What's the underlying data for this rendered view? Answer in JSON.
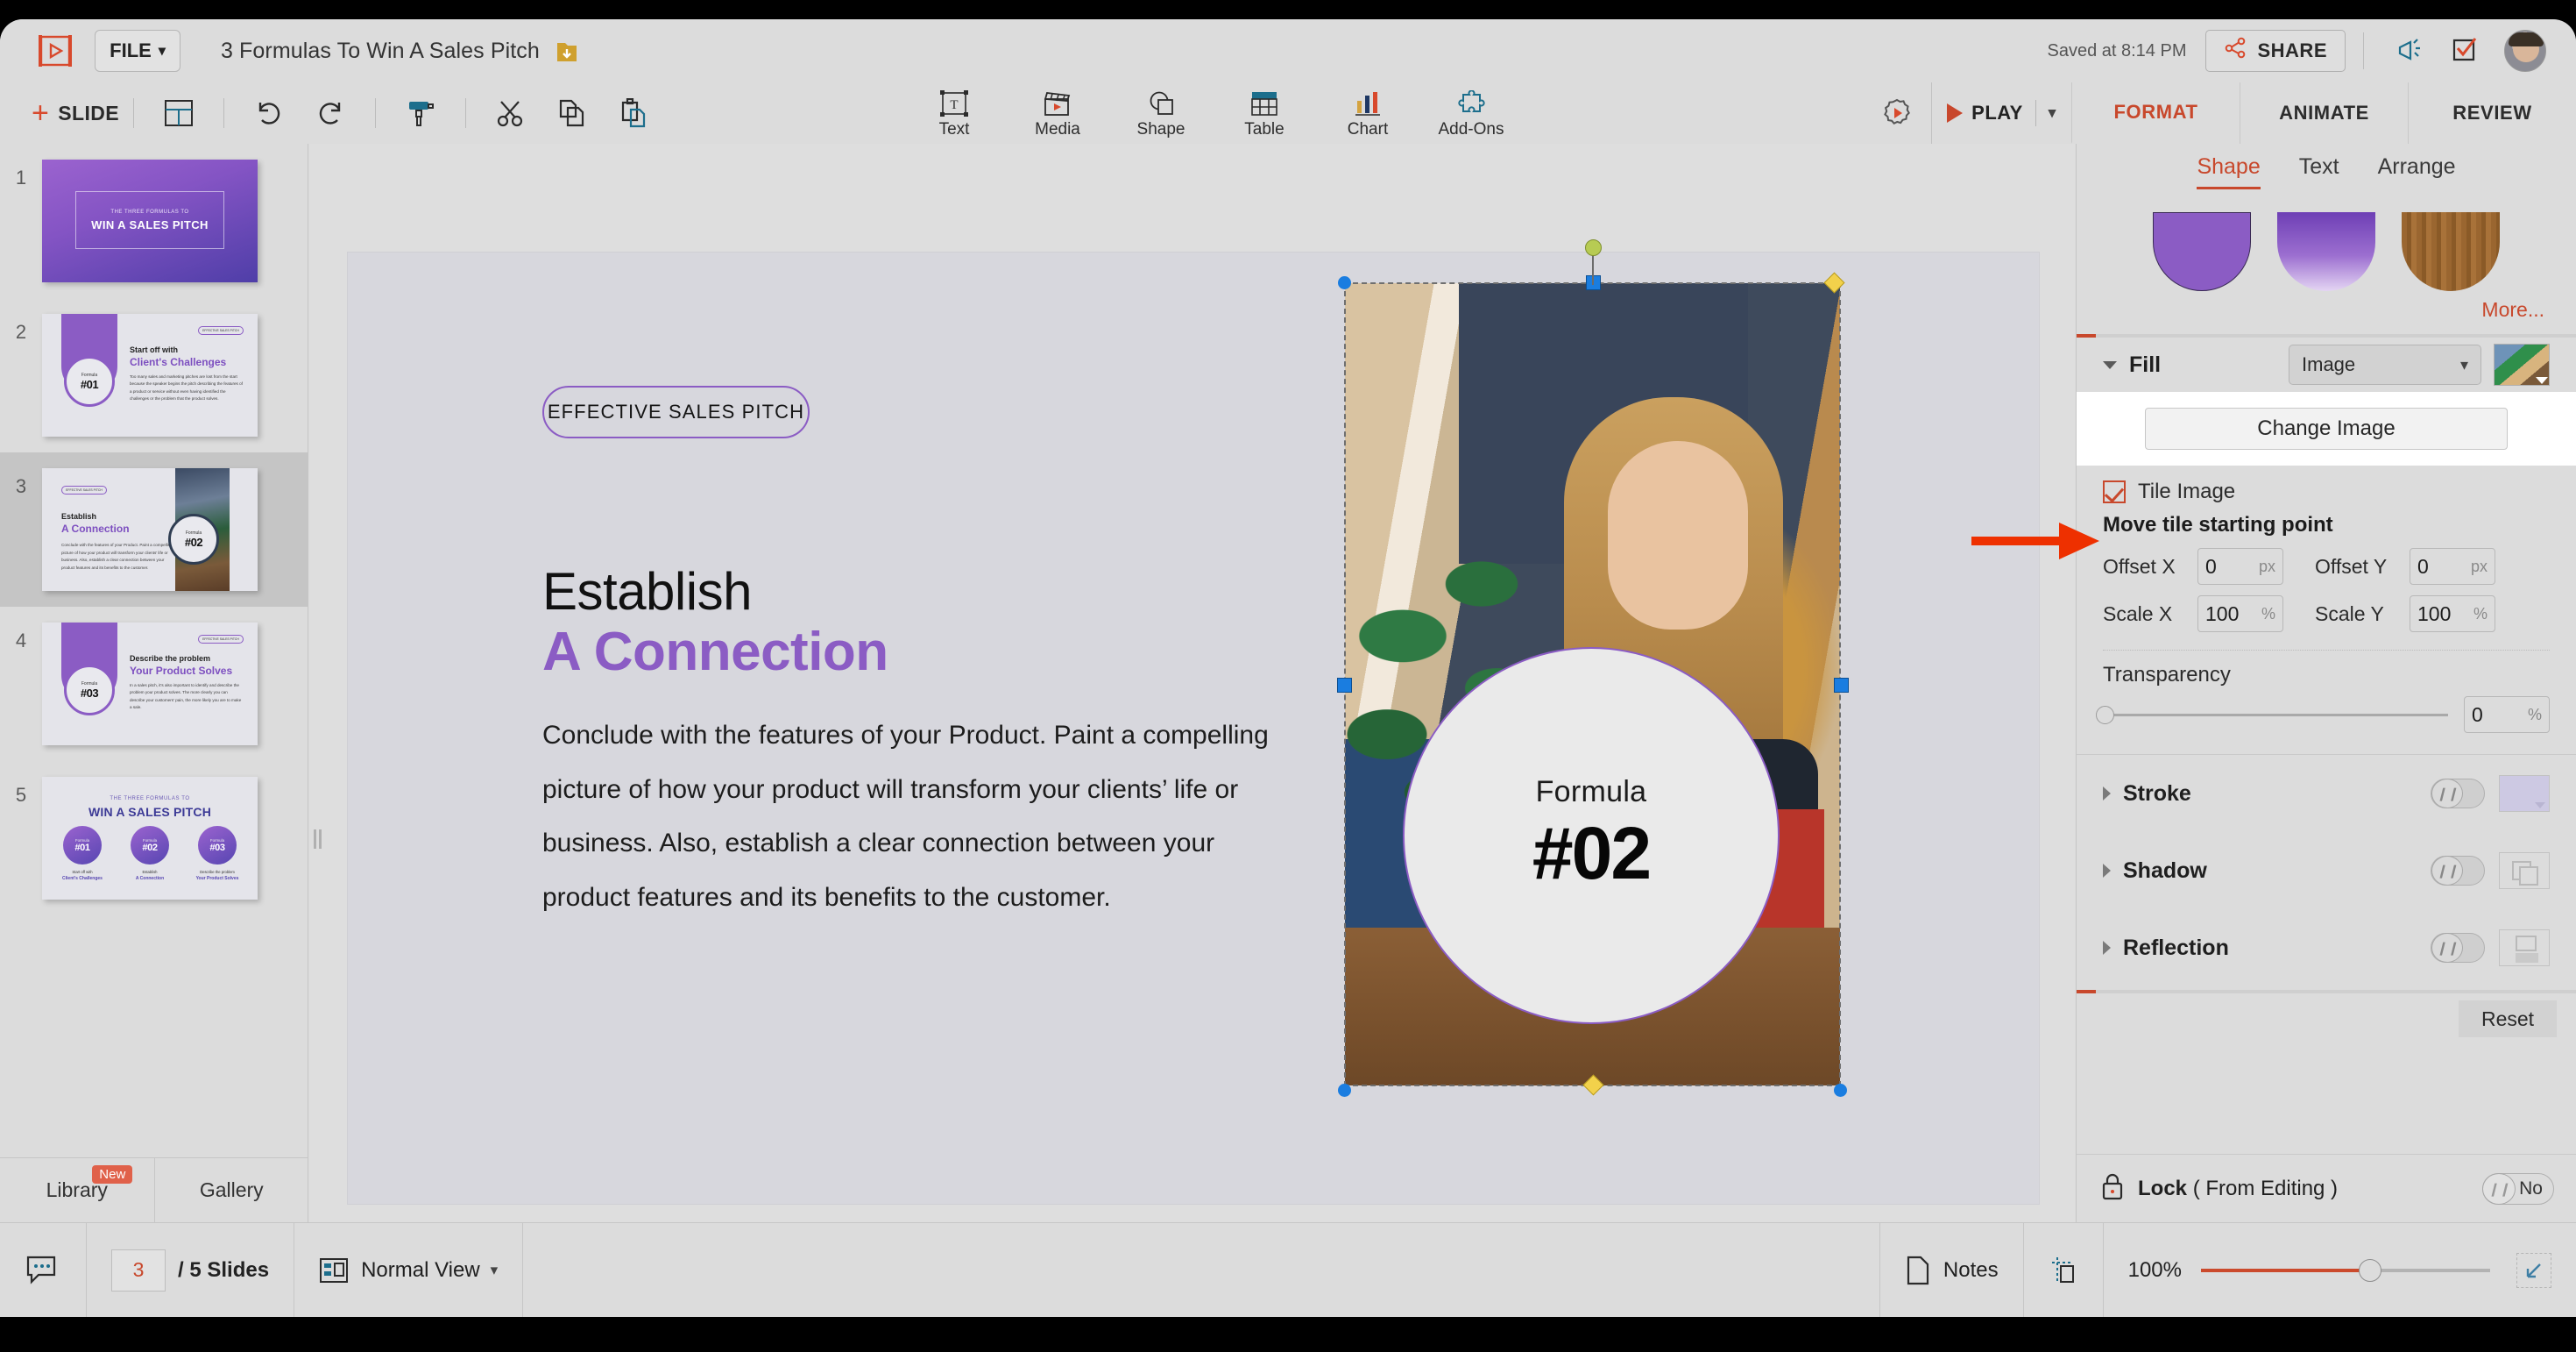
{
  "topbar": {
    "file_label": "FILE",
    "doc_title": "3 Formulas To Win A Sales Pitch",
    "saved_text": "Saved at 8:14 PM",
    "share_label": "SHARE"
  },
  "toolbar": {
    "slide_label": "SLIDE",
    "tools": [
      {
        "name": "text",
        "label": "Text"
      },
      {
        "name": "media",
        "label": "Media"
      },
      {
        "name": "shape",
        "label": "Shape"
      },
      {
        "name": "table",
        "label": "Table"
      },
      {
        "name": "chart",
        "label": "Chart"
      },
      {
        "name": "addons",
        "label": "Add-Ons"
      }
    ],
    "play_label": "PLAY",
    "right_tabs": [
      {
        "label": "FORMAT",
        "active": true
      },
      {
        "label": "ANIMATE",
        "active": false
      },
      {
        "label": "REVIEW",
        "active": false
      }
    ]
  },
  "slides_panel": {
    "slides": [
      {
        "num": "1",
        "eyebrow": "THE THREE FORMULAS TO",
        "title": "WIN A SALES PITCH"
      },
      {
        "num": "2",
        "pill": "EFFECTIVE SALES PITCH",
        "formula_label": "Formula",
        "formula_num": "#01",
        "h1": "Start off with",
        "h2": "Client's Challenges",
        "body": "Too many sales and marketing pitches are lost from the start because the speaker begins the pitch describing the features of a product or service without even having identified the challenges or the problem that the product solves."
      },
      {
        "num": "3",
        "pill": "EFFECTIVE SALES PITCH",
        "formula_label": "Formula",
        "formula_num": "#02",
        "h1": "Establish",
        "h2": "A Connection",
        "body": "Conclude with the features of your Product. Paint a compelling picture of how your product will transform your clients' life or business. Also, establish a clear connection between your product features and its benefits to the customer."
      },
      {
        "num": "4",
        "pill": "EFFECTIVE SALES PITCH",
        "formula_label": "Formula",
        "formula_num": "#03",
        "h1": "Describe the problem",
        "h2": "Your Product Solves",
        "body": "In a sales pitch, it's also important to identify and describe the problem your product solves. The more clearly you can describe your customers' pain, the more likely you are to make a sale."
      },
      {
        "num": "5",
        "eyebrow": "THE THREE FORMULAS TO",
        "title": "WIN A SALES PITCH",
        "cards": [
          {
            "formula_label": "Formula",
            "formula_num": "#01",
            "cap1": "Start off with",
            "cap2": "Client's Challenges"
          },
          {
            "formula_label": "Formula",
            "formula_num": "#02",
            "cap1": "Establish",
            "cap2": "A Connection"
          },
          {
            "formula_label": "Formula",
            "formula_num": "#03",
            "cap1": "Describe the problem",
            "cap2": "Your Product Solves"
          }
        ]
      }
    ],
    "tabs": [
      {
        "label": "Library",
        "badge": "New"
      },
      {
        "label": "Gallery",
        "badge": ""
      }
    ]
  },
  "canvas": {
    "pill": "EFFECTIVE SALES PITCH",
    "heading_line1": "Establish",
    "heading_line2": "A Connection",
    "body": "Conclude with the features of your Product. Paint a compelling picture of how your product will transform your clients’ life or business. Also, establish a clear connection between your product features and its benefits to the customer.",
    "badge_label": "Formula",
    "badge_number": "#02",
    "accent_purple": "#8b5cc4"
  },
  "format_panel": {
    "subtabs": [
      {
        "label": "Shape",
        "active": true
      },
      {
        "label": "Text",
        "active": false
      },
      {
        "label": "Arrange",
        "active": false
      }
    ],
    "more_label": "More...",
    "fill": {
      "label": "Fill",
      "type_value": "Image",
      "change_image_label": "Change Image",
      "tile_image_label": "Tile Image",
      "tile_checked": true,
      "move_tile_label": "Move tile starting point",
      "offset_x_label": "Offset X",
      "offset_x_value": "0",
      "offset_x_unit": "px",
      "offset_y_label": "Offset Y",
      "offset_y_value": "0",
      "offset_y_unit": "px",
      "scale_x_label": "Scale X",
      "scale_x_value": "100",
      "scale_x_unit": "%",
      "scale_y_label": "Scale Y",
      "scale_y_value": "100",
      "scale_y_unit": "%",
      "transparency_label": "Transparency",
      "transparency_value": "0",
      "transparency_unit": "%"
    },
    "stroke_label": "Stroke",
    "shadow_label": "Shadow",
    "reflection_label": "Reflection",
    "reset_label": "Reset",
    "lock_label_bold": "Lock",
    "lock_label_rest": "( From Editing )",
    "lock_value": "No",
    "accent_red": "#c8482c"
  },
  "bottombar": {
    "current_slide": "3",
    "slide_count": "/ 5 Slides",
    "view_mode": "Normal View",
    "notes_label": "Notes",
    "zoom_label": "100%"
  }
}
